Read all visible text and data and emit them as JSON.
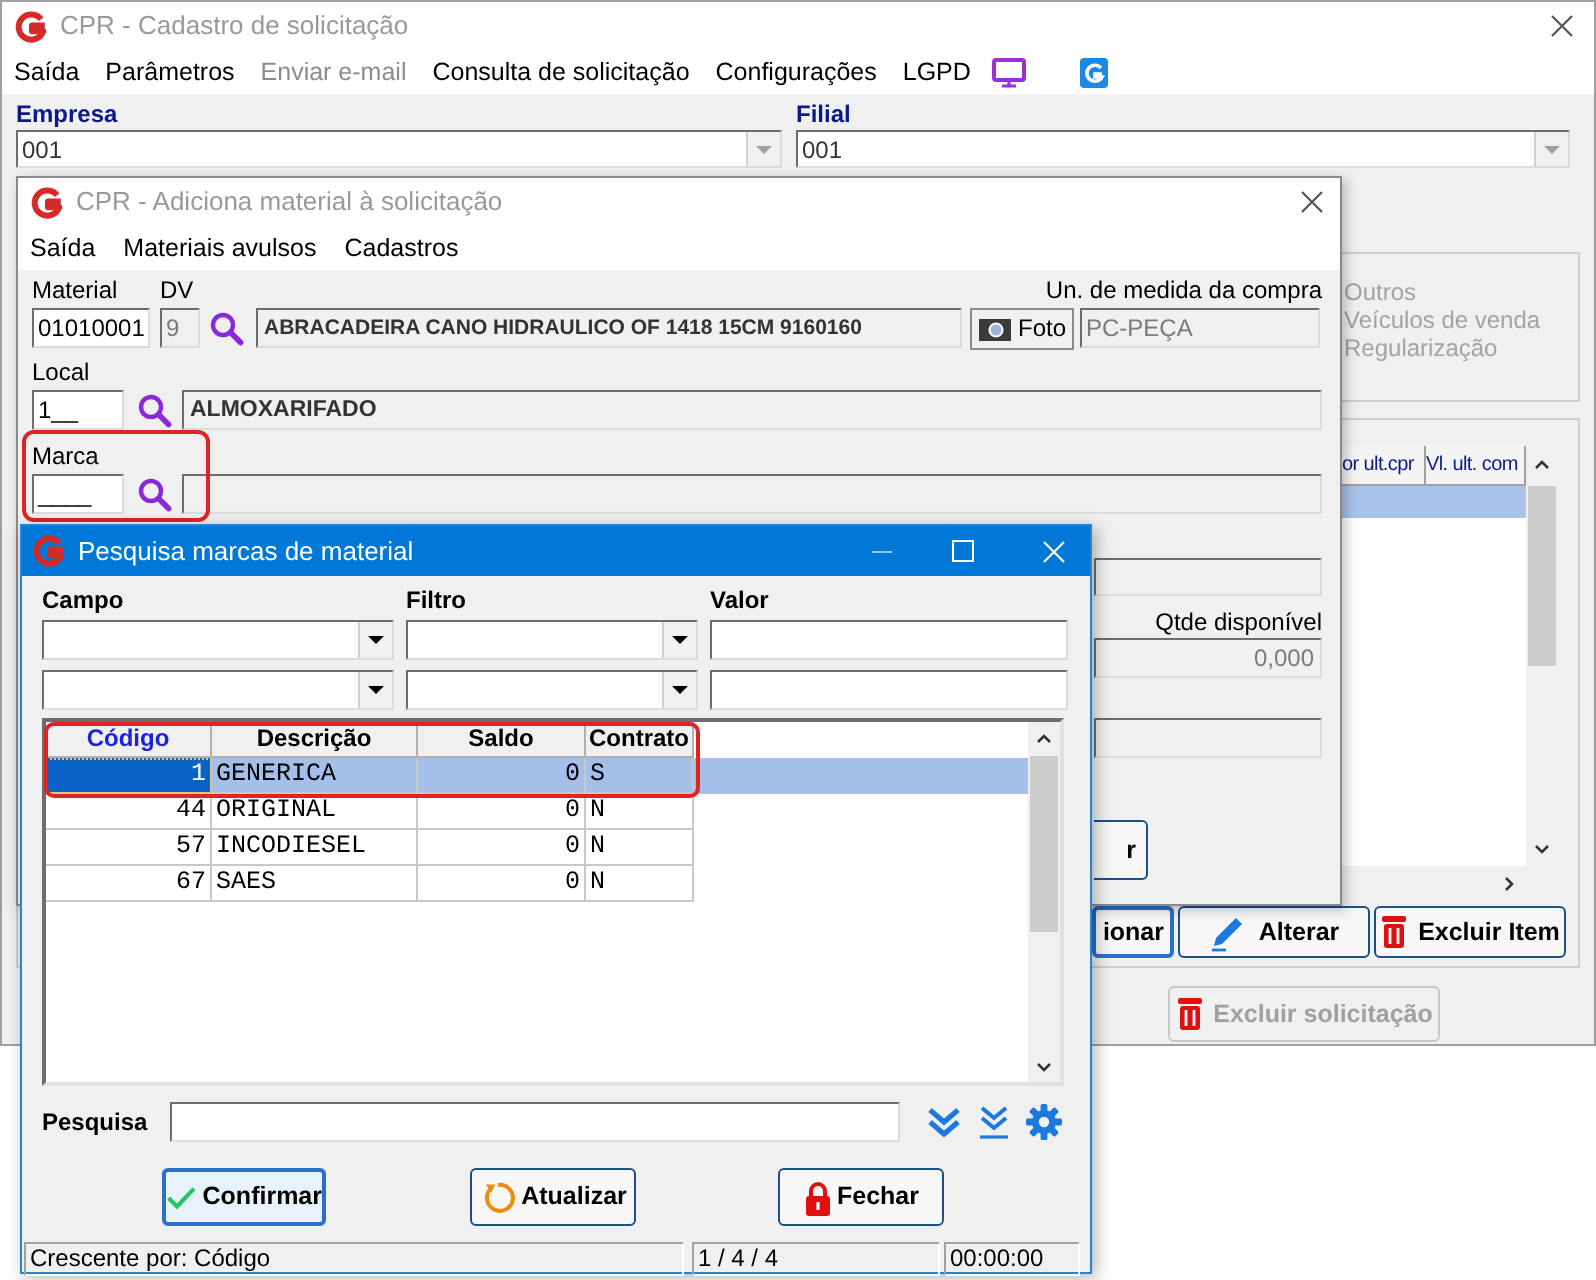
{
  "main_window": {
    "title": "CPR - Cadastro de solicitação",
    "active": false,
    "menu": [
      {
        "label": "Saída",
        "disabled": false
      },
      {
        "label": "Parâmetros",
        "disabled": false
      },
      {
        "label": "Enviar e-mail",
        "disabled": true
      },
      {
        "label": "Consulta de solicitação",
        "disabled": false
      },
      {
        "label": "Configurações",
        "disabled": false
      },
      {
        "label": "LGPD",
        "disabled": false
      }
    ],
    "empresa": {
      "label": "Empresa",
      "value": "001"
    },
    "filial": {
      "label": "Filial",
      "value": "001"
    },
    "options": [
      {
        "label": "Outros",
        "disabled": true
      },
      {
        "label": "Veículos de venda",
        "disabled": true
      },
      {
        "label": "Regularização",
        "disabled": true
      }
    ],
    "items_table": {
      "columns": [
        "or ult.cpr",
        "Vl. ult. com"
      ],
      "rows": [
        {
          "selected": true
        }
      ]
    },
    "buttons": [
      {
        "label": "ionar",
        "kind": "plain",
        "default": true
      },
      {
        "label": "Alterar",
        "kind": "edit",
        "default": false
      },
      {
        "label": "Excluir Item",
        "kind": "delete",
        "default": false
      }
    ],
    "delete_request_button": {
      "label": "Excluir solicitação",
      "disabled": true
    }
  },
  "material_dialog": {
    "title": "CPR - Adiciona material à solicitação",
    "active": false,
    "menu": [
      "Saída",
      "Materiais avulsos",
      "Cadastros"
    ],
    "material": {
      "label": "Material",
      "value": "01010001"
    },
    "dv": {
      "label": "DV",
      "value": "9",
      "disabled": true
    },
    "description": "ABRACADEIRA CANO HIDRAULICO OF 1418 15CM 9160160",
    "photo_button": "Foto",
    "unit": {
      "label": "Un. de medida da compra",
      "value": "PC-PEÇA",
      "disabled": true
    },
    "local": {
      "label": "Local",
      "value": "1__",
      "description": "ALMOXARIFADO"
    },
    "marca": {
      "label": "Marca",
      "value": "____",
      "highlighted": true
    },
    "qtde": {
      "label": "Qtde disponível",
      "value": "0,000",
      "disabled": true
    },
    "partial_button": "r"
  },
  "search_dialog": {
    "title": "Pesquisa marcas de material",
    "active": true,
    "filter_labels": [
      "Campo",
      "Filtro",
      "Valor"
    ],
    "table": {
      "highlighted": true,
      "columns": [
        {
          "label": "Código",
          "sorted": true
        },
        {
          "label": "Descrição",
          "sorted": false
        },
        {
          "label": "Saldo",
          "sorted": false
        },
        {
          "label": "Contrato",
          "sorted": false
        }
      ],
      "rows": [
        {
          "cells": [
            "1",
            "GENERICA",
            "0",
            "S"
          ],
          "selected": true
        },
        {
          "cells": [
            "44",
            "ORIGINAL",
            "0",
            "N"
          ],
          "selected": false
        },
        {
          "cells": [
            "57",
            "INCODIESEL",
            "0",
            "N"
          ],
          "selected": false
        },
        {
          "cells": [
            "67",
            "SAES",
            "0",
            "N"
          ],
          "selected": false
        }
      ]
    },
    "search_label": "Pesquisa",
    "buttons": [
      {
        "label": "Confirmar",
        "kind": "confirm",
        "default": true
      },
      {
        "label": "Atualizar",
        "kind": "refresh",
        "default": false
      },
      {
        "label": "Fechar",
        "kind": "close",
        "default": false
      }
    ],
    "status": [
      "Crescente por: Código",
      "1 / 4 / 4",
      "00:00:00"
    ]
  }
}
